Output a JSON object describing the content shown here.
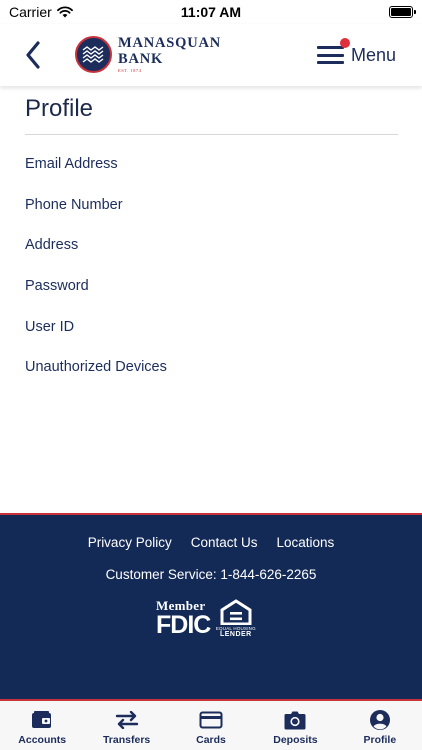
{
  "status_bar": {
    "carrier": "Carrier",
    "time": "11:07 AM"
  },
  "header": {
    "logo_line1": "MANASQUAN",
    "logo_line2": "BANK",
    "logo_est": "EST. 1874",
    "menu_label": "Menu"
  },
  "page": {
    "title": "Profile"
  },
  "profile_items": [
    "Email Address",
    "Phone Number",
    "Address",
    "Password",
    "User ID",
    "Unauthorized Devices"
  ],
  "footer": {
    "links": [
      "Privacy Policy",
      "Contact Us",
      "Locations"
    ],
    "customer_service": "Customer Service: 1-844-626-2265",
    "fdic_member": "Member",
    "fdic_text": "FDIC",
    "ehl_small": "EQUAL HOUSING",
    "ehl_big": "LENDER"
  },
  "tabs": [
    {
      "label": "Accounts",
      "icon": "wallet-icon"
    },
    {
      "label": "Transfers",
      "icon": "transfer-arrows-icon"
    },
    {
      "label": "Cards",
      "icon": "credit-card-icon"
    },
    {
      "label": "Deposits",
      "icon": "camera-icon"
    },
    {
      "label": "Profile",
      "icon": "user-circle-icon"
    }
  ],
  "colors": {
    "navy": "#132a57",
    "accent_red": "#c8323b",
    "text": "#1c2d5c"
  }
}
